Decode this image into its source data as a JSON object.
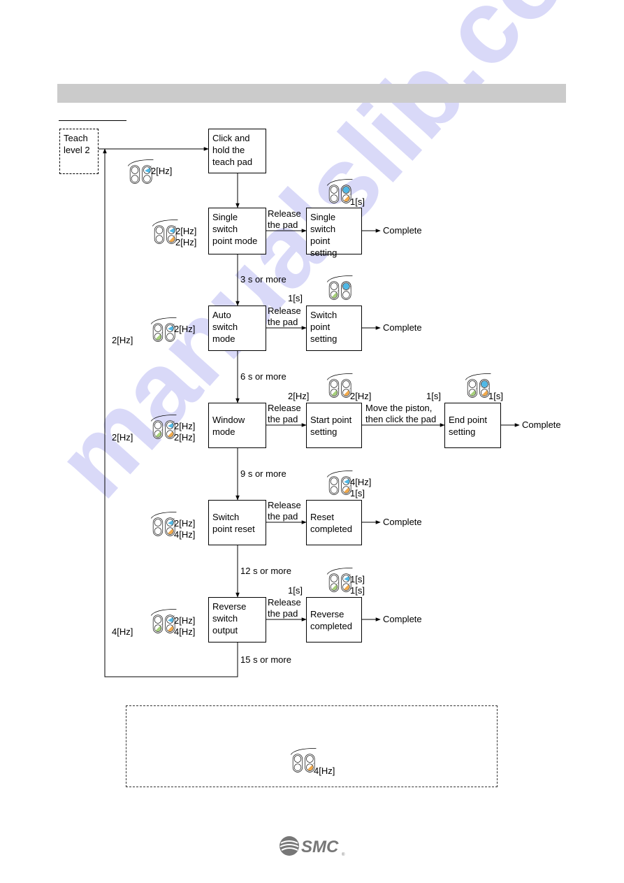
{
  "watermark": "manualslib.com",
  "colors": {
    "blue": "#4fb8e6",
    "green": "#a6cf7a",
    "orange": "#f2a94a",
    "header": "#cbcbcb"
  },
  "start": {
    "label": "Teach\nlevel 2"
  },
  "nodes": {
    "click_hold": "Click and\nhold the\nteach pad",
    "single_mode": "Single\nswitch\npoint mode",
    "single_setting": "Single\nswitch\npoint setting",
    "auto_mode": "Auto\nswitch\nmode",
    "switch_setting": "Switch\npoint\nsetting",
    "window_mode": "Window\nmode",
    "start_point": "Start point\nsetting",
    "end_point": "End point\nsetting",
    "reset_mode": "Switch\npoint reset",
    "reset_completed": "Reset\ncompleted",
    "reverse_mode": "Reverse\nswitch\noutput",
    "reverse_completed": "Reverse\ncompleted"
  },
  "edges": {
    "release": "Release\nthe pad",
    "move_piston": "Move the piston,\nthen click the pad",
    "complete": "Complete",
    "t3": "3 s or more",
    "t6": "6 s or more",
    "t9": "9 s or more",
    "t12": "12 s or more",
    "t15": "15 s or more"
  },
  "leds": [
    {
      "id": "click-hold",
      "states": {
        "tl": "off",
        "tr": "blink-blue",
        "bl": "off",
        "br": "off"
      },
      "labels": {
        "tr": "2[Hz]"
      }
    },
    {
      "id": "single-mode",
      "states": {
        "tl": "off",
        "tr": "blink-blue",
        "bl": "off",
        "br": "blink-orange"
      },
      "labels": {
        "tr": "2[Hz]",
        "br": "2[Hz]"
      }
    },
    {
      "id": "single-setting",
      "states": {
        "tl": "off",
        "tr": "on-blue",
        "bl": "off",
        "br": "blink-orange"
      },
      "labels": {
        "br": "1[s]"
      }
    },
    {
      "id": "auto-mode",
      "states": {
        "tl": "off",
        "tr": "blink-blue",
        "bl": "blink-green",
        "br": "off"
      },
      "labels": {
        "tr": "2[Hz]",
        "bl": "2[Hz]"
      }
    },
    {
      "id": "switch-setting",
      "states": {
        "tl": "off",
        "tr": "on-blue",
        "bl": "blink-green",
        "br": "off"
      },
      "labels": {
        "bl": "1[s]"
      }
    },
    {
      "id": "window-mode",
      "states": {
        "tl": "off",
        "tr": "blink-blue",
        "bl": "blink-green",
        "br": "blink-orange"
      },
      "labels": {
        "tr": "2[Hz]",
        "br": "2[Hz]",
        "bl": "2[Hz]"
      }
    },
    {
      "id": "start-point",
      "states": {
        "tl": "off",
        "tr": "off",
        "bl": "blink-green",
        "br": "blink-orange"
      },
      "labels": {
        "bl": "2[Hz]",
        "br": "2[Hz]"
      }
    },
    {
      "id": "end-point",
      "states": {
        "tl": "off",
        "tr": "on-blue",
        "bl": "blink-green",
        "br": "blink-orange"
      },
      "labels": {
        "bl": "1[s]",
        "br": "1[s]"
      }
    },
    {
      "id": "reset-mode",
      "states": {
        "tl": "off",
        "tr": "blink-blue",
        "bl": "off",
        "br": "blink-orange"
      },
      "labels": {
        "tr": "2[Hz]",
        "br": "4[Hz]"
      }
    },
    {
      "id": "reset-completed",
      "states": {
        "tl": "off",
        "tr": "blink-blue",
        "bl": "off",
        "br": "blink-orange"
      },
      "labels": {
        "tr": "4[Hz]",
        "br": "1[s]"
      }
    },
    {
      "id": "reverse-mode",
      "states": {
        "tl": "off",
        "tr": "blink-blue",
        "bl": "blink-green",
        "br": "blink-orange"
      },
      "labels": {
        "tr": "2[Hz]",
        "br": "4[Hz]",
        "bl": "4[Hz]"
      }
    },
    {
      "id": "reverse-completed",
      "states": {
        "tl": "off",
        "tr": "blink-blue",
        "bl": "blink-green",
        "br": "blink-orange"
      },
      "labels": {
        "tr": "1[s]",
        "br": "1[s]",
        "bl": "1[s]"
      }
    },
    {
      "id": "note",
      "states": {
        "tl": "off",
        "tr": "off",
        "bl": "off",
        "br": "blink-orange"
      },
      "labels": {
        "br": "4[Hz]"
      }
    }
  ],
  "logo": {
    "text": "SMC"
  }
}
